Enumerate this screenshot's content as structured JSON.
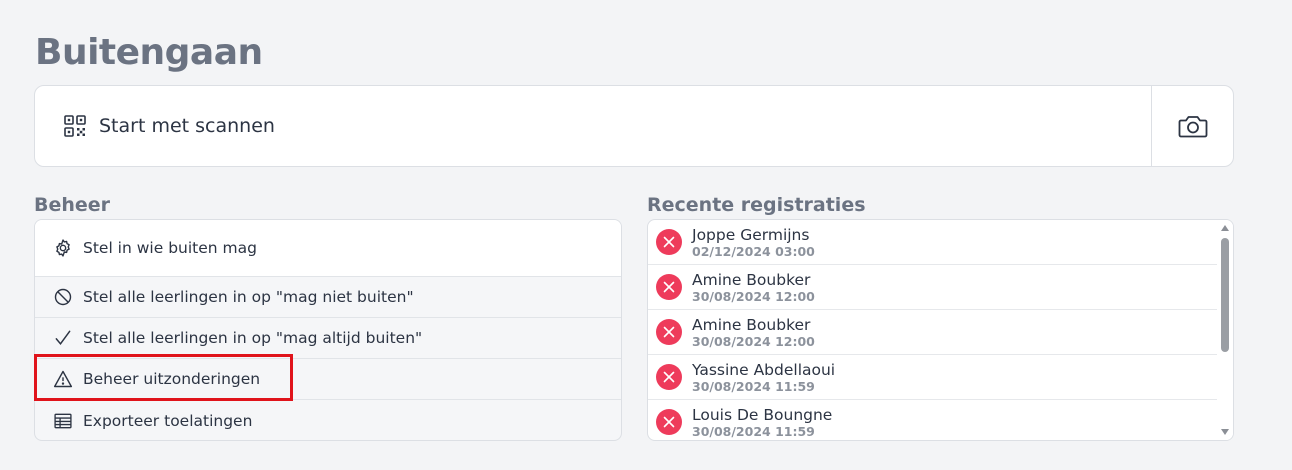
{
  "page": {
    "title": "Buitengaan"
  },
  "scanner": {
    "label": "Start met scannen",
    "qr_icon": "qr-code-icon",
    "camera_icon": "camera-icon"
  },
  "beheer": {
    "heading": "Beheer",
    "items": [
      {
        "label": "Stel in wie buiten mag",
        "icon": "gear-icon"
      },
      {
        "label": "Stel alle leerlingen in op \"mag niet buiten\"",
        "icon": "prohibited-icon"
      },
      {
        "label": "Stel alle leerlingen in op \"mag altijd buiten\"",
        "icon": "checkmark-icon"
      },
      {
        "label": "Beheer uitzonderingen",
        "icon": "warning-icon"
      },
      {
        "label": "Exporteer toelatingen",
        "icon": "table-icon"
      }
    ],
    "highlighted_item": "Beheer uitzonderingen"
  },
  "recent": {
    "heading": "Recente registraties",
    "items": [
      {
        "name": "Joppe Germijns",
        "date": "02/12/2024 03:00",
        "status": "denied"
      },
      {
        "name": "Amine Boubker",
        "date": "30/08/2024 12:00",
        "status": "denied"
      },
      {
        "name": "Amine Boubker",
        "date": "30/08/2024 12:00",
        "status": "denied"
      },
      {
        "name": "Yassine Abdellaoui",
        "date": "30/08/2024 11:59",
        "status": "denied"
      },
      {
        "name": "Louis De Boungne",
        "date": "30/08/2024 11:59",
        "status": "denied"
      }
    ]
  },
  "colors": {
    "title": "#6b7382",
    "status_denied": "#ee3b5b",
    "highlight": "#e0131b",
    "background": "#f3f4f6"
  }
}
